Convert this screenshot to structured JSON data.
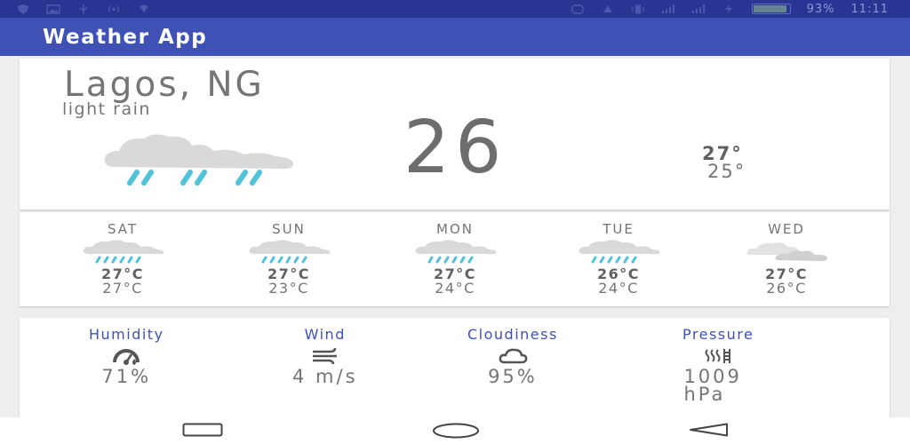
{
  "status_bar": {
    "battery_percent": "93%",
    "time": "11:11",
    "battery_level": 0.93,
    "icons": [
      "shield-icon",
      "image-icon",
      "usb-icon",
      "radio-icon",
      "location-icon",
      "nfc-icon",
      "data-icon",
      "vibrate-icon",
      "signal-icon",
      "wifi-icon",
      "signal-icon",
      "charging-icon"
    ]
  },
  "app_bar": {
    "title": "Weather App"
  },
  "current": {
    "city": "Lagos, NG",
    "description": "light rain",
    "temperature": "26",
    "high": "27°",
    "low": "25°",
    "icon": "rain-cloud-icon"
  },
  "forecast": [
    {
      "day": "SAT",
      "high": "27°C",
      "low": "27°C",
      "icon": "rain-cloud-icon"
    },
    {
      "day": "SUN",
      "high": "27°C",
      "low": "23°C",
      "icon": "rain-cloud-icon"
    },
    {
      "day": "MON",
      "high": "27°C",
      "low": "24°C",
      "icon": "rain-cloud-icon"
    },
    {
      "day": "TUE",
      "high": "26°C",
      "low": "24°C",
      "icon": "rain-cloud-icon"
    },
    {
      "day": "WED",
      "high": "27°C",
      "low": "26°C",
      "icon": "clouds-icon"
    }
  ],
  "details": {
    "humidity": {
      "label": "Humidity",
      "value": "71%",
      "icon": "gauge-icon"
    },
    "wind": {
      "label": "Wind",
      "value": "4 m/s",
      "icon": "wind-icon"
    },
    "cloudiness": {
      "label": "Cloudiness",
      "value": "95%",
      "icon": "cloud-outline-icon"
    },
    "pressure": {
      "label": "Pressure",
      "value_number": "1009",
      "value_unit": "hPa",
      "icon": "pressure-icon"
    }
  },
  "nav_bar": {
    "buttons": [
      "recents-button",
      "home-button",
      "back-button"
    ]
  },
  "colors": {
    "status_bar": "#283593",
    "app_bar": "#3f51b5",
    "accent_label": "#3f51b5",
    "rain_drops": "#4fc3d9",
    "cloud": "#dadada",
    "background": "#eeeeee"
  }
}
